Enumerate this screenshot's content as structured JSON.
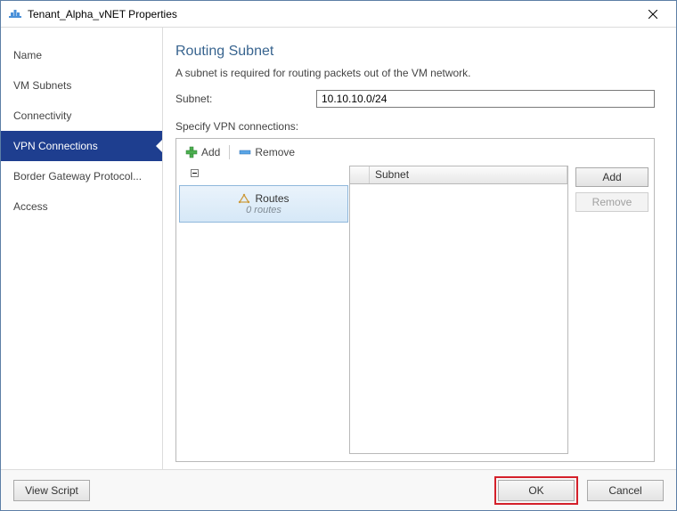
{
  "window": {
    "title": "Tenant_Alpha_vNET Properties"
  },
  "sidebar": {
    "items": [
      {
        "label": "Name"
      },
      {
        "label": "VM Subnets"
      },
      {
        "label": "Connectivity"
      },
      {
        "label": "VPN Connections"
      },
      {
        "label": "Border Gateway Protocol..."
      },
      {
        "label": "Access"
      }
    ]
  },
  "content": {
    "heading": "Routing Subnet",
    "description": "A subnet is required for routing packets out of the VM network.",
    "subnet_label": "Subnet:",
    "subnet_value": "10.10.10.0/24",
    "specify_label": "Specify VPN connections:",
    "toolbar": {
      "add": "Add",
      "remove": "Remove"
    },
    "tree": {
      "routes_label": "Routes",
      "routes_sub": "0 routes"
    },
    "table": {
      "col_subnet": "Subnet"
    },
    "side_buttons": {
      "add": "Add",
      "remove": "Remove"
    }
  },
  "footer": {
    "view_script": "View Script",
    "ok": "OK",
    "cancel": "Cancel"
  }
}
